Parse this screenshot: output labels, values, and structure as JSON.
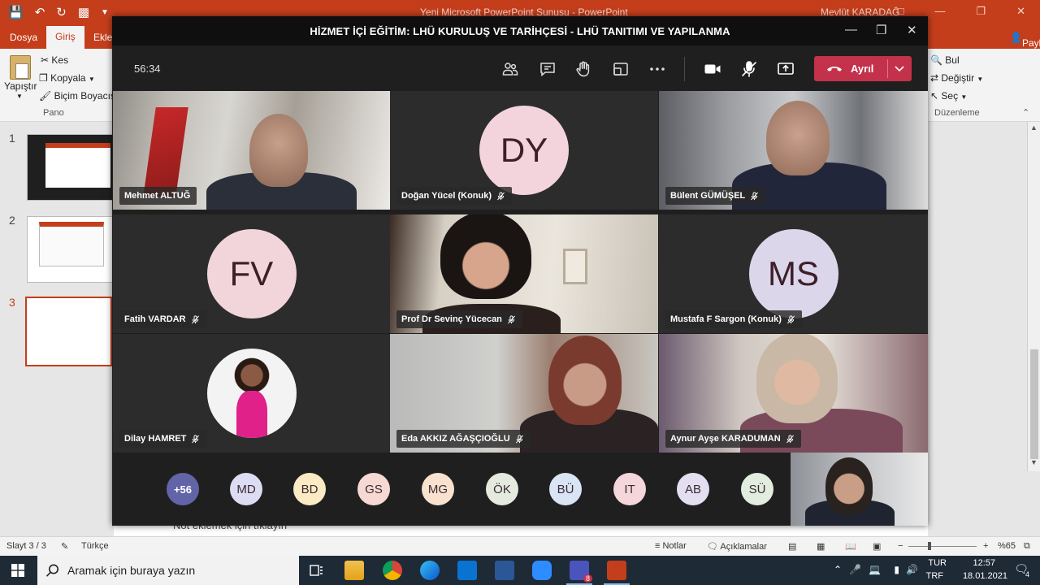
{
  "powerpoint": {
    "doc_title": "Yeni Microsoft PowerPoint Sunusu  -  PowerPoint",
    "user": "Mevlüt KARADAĞ",
    "tabs": {
      "dosya": "Dosya",
      "giris": "Giriş",
      "ekle": "Ekle",
      "share": "Paylaş"
    },
    "clipboard": {
      "paste": "Yapıştır",
      "cut": "Kes",
      "copy": "Kopyala",
      "format_painter": "Biçim Boyacısı",
      "group": "Pano"
    },
    "editing": {
      "find": "Bul",
      "replace": "Değiştir",
      "select": "Seç",
      "group": "Düzenleme"
    },
    "slides": [
      "1",
      "2",
      "3"
    ],
    "notes_placeholder": "Not eklemek için tıklayın",
    "status": {
      "slide": "Slayt 3 / 3",
      "language": "Türkçe",
      "notes": "Notlar",
      "comments": "Açıklamalar",
      "zoom": "%65"
    }
  },
  "meeting": {
    "title": "HİZMET İÇİ EĞİTİM: LHÜ KURULUŞ VE TARİHÇESİ - LHÜ TANITIMI VE YAPILANMA",
    "timer": "56:34",
    "leave_label": "Ayrıl",
    "participants": [
      {
        "name": "Mehmet ALTUĞ",
        "muted": false,
        "initials": ""
      },
      {
        "name": "Doğan Yücel (Konuk)",
        "muted": true,
        "initials": "DY",
        "color": "#f3d4dc"
      },
      {
        "name": "Bülent GÜMÜŞEL",
        "muted": true,
        "initials": ""
      },
      {
        "name": "Fatih VARDAR",
        "muted": true,
        "initials": "FV",
        "color": "#f1d5da"
      },
      {
        "name": "Prof Dr Sevinç Yücecan",
        "muted": true,
        "initials": ""
      },
      {
        "name": "Mustafa F Sargon (Konuk)",
        "muted": true,
        "initials": "MS",
        "color": "#dcd6ea"
      },
      {
        "name": "Dilay HAMRET",
        "muted": true,
        "initials": ""
      },
      {
        "name": "Eda AKKIZ AĞAŞÇIOĞLU",
        "muted": true,
        "initials": ""
      },
      {
        "name": "Aynur Ayşe KARADUMAN",
        "muted": true,
        "initials": ""
      }
    ],
    "overflow_count": "+56",
    "strip": [
      {
        "initials": "MD",
        "color": "#dcdcf2"
      },
      {
        "initials": "BD",
        "color": "#fbeac3"
      },
      {
        "initials": "GS",
        "color": "#f6d9d3"
      },
      {
        "initials": "MG",
        "color": "#f8e2cf"
      },
      {
        "initials": "ÖK",
        "color": "#e5eadf"
      },
      {
        "initials": "BÜ",
        "color": "#d9e4f5"
      },
      {
        "initials": "IT",
        "color": "#f4d6db"
      },
      {
        "initials": "AB",
        "color": "#e3dff0"
      },
      {
        "initials": "SÜ",
        "color": "#e2ecdf"
      }
    ]
  },
  "taskbar": {
    "search_placeholder": "Aramak için buraya yazın",
    "language": "TUR",
    "keyboard": "TRF",
    "time": "12:57",
    "date": "18.01.2021",
    "notifications": "4",
    "teams_badge": "8"
  }
}
